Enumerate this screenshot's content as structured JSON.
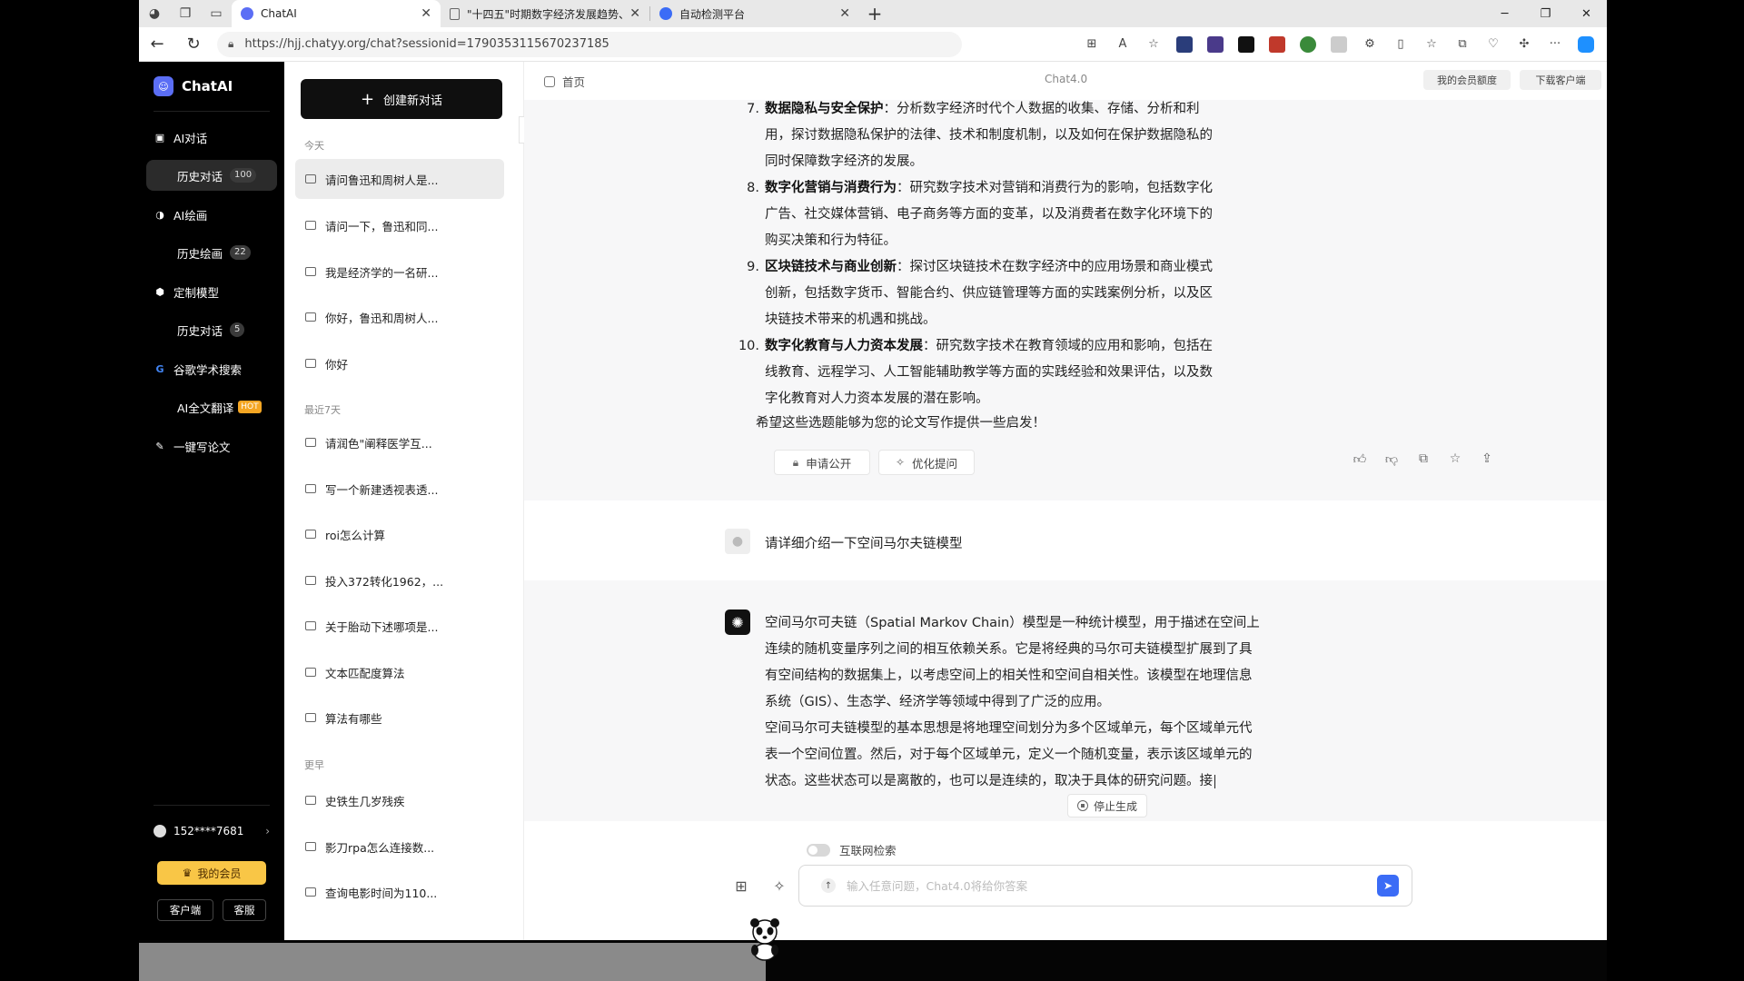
{
  "browser": {
    "tabs": [
      {
        "title": "ChatAI",
        "favicon_color": "#5b6ef5",
        "active": true
      },
      {
        "title": "\"十四五\"时期数字经济发展趋势、",
        "favicon_color": "#666666",
        "active": false
      },
      {
        "title": "自动检测平台",
        "favicon_color": "#3b6cf6",
        "active": false
      }
    ],
    "url": "https://hjj.chatyy.org/chat?sessionid=1790353115670237185"
  },
  "leftnav": {
    "brand": "ChatAI",
    "items": [
      {
        "label": "AI对话",
        "icon": "chat-icon"
      },
      {
        "label": "历史对话",
        "badge": "100"
      },
      {
        "label": "AI绘画",
        "icon": "palette-icon"
      },
      {
        "label": "历史绘画",
        "badge": "22"
      },
      {
        "label": "定制模型",
        "icon": "hexagon-icon"
      },
      {
        "label": "历史对话",
        "badge": "5"
      },
      {
        "label": "谷歌学术搜索",
        "icon": "google-icon"
      },
      {
        "label": "AI全文翻译",
        "tag": "HOT"
      },
      {
        "label": "一键写论文",
        "icon": "ai-pen-icon"
      }
    ],
    "user": "152****7681",
    "vip": "我的会员",
    "client": "客户端",
    "service": "客服"
  },
  "history": {
    "new_chat": "创建新对话",
    "groups": [
      {
        "label": "今天",
        "items": [
          "请问鲁迅和周树人是...",
          "请问一下，鲁迅和同...",
          "我是经济学的一名研...",
          "你好，鲁迅和周树人...",
          "你好"
        ]
      },
      {
        "label": "最近7天",
        "items": [
          "请润色\"阐释医学互...",
          "写一个新建透视表透...",
          "roi怎么计算",
          "投入372转化1962，...",
          "关于胎动下述哪项是...",
          "文本匹配度算法",
          "算法有哪些"
        ]
      },
      {
        "label": "更早",
        "items": [
          "史铁生几岁残疾",
          "影刀rpa怎么连接数...",
          "查询电影时间为110..."
        ]
      }
    ]
  },
  "topbar": {
    "home": "首页",
    "model": "Chat4.0",
    "membership": "我的会员额度",
    "download": "下载客户端"
  },
  "answer1": {
    "items": [
      {
        "num": "7.",
        "title": "数据隐私与安全保护",
        "lines": [
          "：分析数字经济时代个人数据的收集、存储、分析和利",
          "用，探讨数据隐私保护的法律、技术和制度机制，以及如何在保护数据隐私的",
          "同时保障数字经济的发展。"
        ]
      },
      {
        "num": "8.",
        "title": "数字化营销与消费行为",
        "lines": [
          "：研究数字技术对营销和消费行为的影响，包括数字化",
          "广告、社交媒体营销、电子商务等方面的变革，以及消费者在数字化环境下的",
          "购买决策和行为特征。"
        ]
      },
      {
        "num": "9.",
        "title": "区块链技术与商业创新",
        "lines": [
          "：探讨区块链技术在数字经济中的应用场景和商业模式",
          "创新，包括数字货币、智能合约、供应链管理等方面的实践案例分析，以及区",
          "块链技术带来的机遇和挑战。"
        ]
      },
      {
        "num": "10.",
        "title": "数字化教育与人力资本发展",
        "lines": [
          "：研究数字技术在教育领域的应用和影响，包括在",
          "线教育、远程学习、人工智能辅助教学等方面的实践经验和效果评估，以及数",
          "字化教育对人力资本发展的潜在影响。"
        ]
      }
    ],
    "closing": "希望这些选题能够为您的论文写作提供一些启发！",
    "apply_public": "申请公开",
    "optimize": "优化提问"
  },
  "question": "请详细介绍一下空间马尔夫链模型",
  "answer2": {
    "lines": [
      "空间马尔可夫链（Spatial Markov Chain）模型是一种统计模型，用于描述在空间上",
      "连续的随机变量序列之间的相互依赖关系。它是将经典的马尔可夫链模型扩展到了具",
      "有空间结构的数据集上，以考虑空间上的相关性和空间自相关性。该模型在地理信息",
      "系统（GIS）、生态学、经济学等领域中得到了广泛的应用。",
      "空间马尔可夫链模型的基本思想是将地理空间划分为多个区域单元，每个区域单元代",
      "表一个空间位置。然后，对于每个区域单元，定义一个随机变量，表示该区域单元的",
      "状态。这些状态可以是离散的，也可以是连续的，取决于具体的研究问题。接"
    ],
    "stop": "停止生成"
  },
  "input": {
    "web_search": "互联网检索",
    "placeholder": "输入任意问题，Chat4.0将给你答案"
  }
}
